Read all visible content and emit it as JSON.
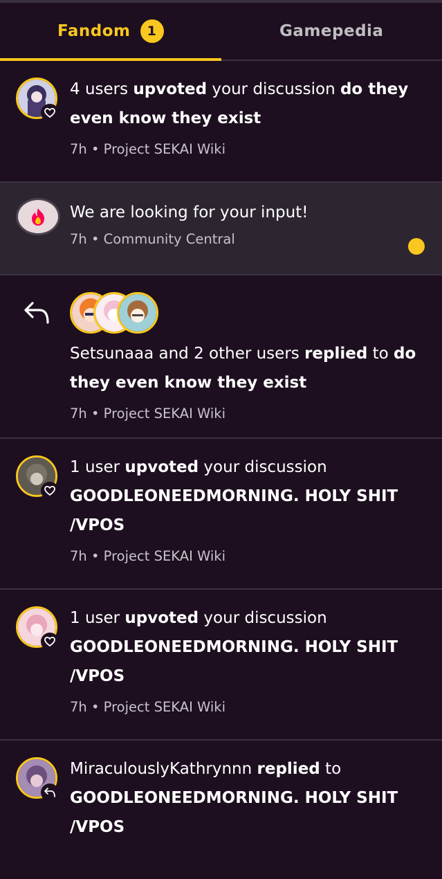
{
  "tabs": [
    {
      "label": "Fandom",
      "badge": "1",
      "active": true
    },
    {
      "label": "Gamepedia",
      "active": false
    }
  ],
  "notifications": [
    {
      "type": "upvote",
      "pre": "4 users ",
      "action": "upvoted",
      "mid": " your discussion ",
      "title": "do they even know they exist",
      "time": "7h",
      "sep": " • ",
      "wiki": "Project SEKAI Wiki",
      "icon": "heart-icon"
    },
    {
      "type": "announcement",
      "text": "We are looking for your input!",
      "time": "7h",
      "sep": " • ",
      "wiki": "Community Central",
      "unread": true,
      "icon": "fandom-flame-icon"
    },
    {
      "type": "reply",
      "pre": "Setsunaaa and 2 other users ",
      "action": "replied",
      "mid": " to ",
      "title": "do they even know they exist",
      "time": "7h",
      "sep": " • ",
      "wiki": "Project SEKAI Wiki",
      "icon": "reply-arrow-icon"
    },
    {
      "type": "upvote",
      "pre": "1 user ",
      "action": "upvoted",
      "mid": " your discussion",
      "title": "GOODLEONEEDMORNING. HOLY SHIT /VPOS",
      "time": "7h",
      "sep": " • ",
      "wiki": "Project SEKAI Wiki",
      "icon": "heart-icon"
    },
    {
      "type": "upvote",
      "pre": "1 user ",
      "action": "upvoted",
      "mid": " your discussion",
      "title": "GOODLEONEEDMORNING. HOLY SHIT /VPOS",
      "time": "7h",
      "sep": " • ",
      "wiki": "Project SEKAI Wiki",
      "icon": "heart-icon"
    },
    {
      "type": "reply",
      "pre": "MiraculouslyKathrynnn ",
      "action": "replied",
      "mid": " to",
      "title": "GOODLEONEEDMORNING. HOLY SHIT /VPOS",
      "icon": "reply-arrow-icon"
    }
  ],
  "colors": {
    "accent": "#f9c71f",
    "background": "#1d0f1f",
    "highlight": "#2d2530",
    "divider": "#3a3140"
  }
}
